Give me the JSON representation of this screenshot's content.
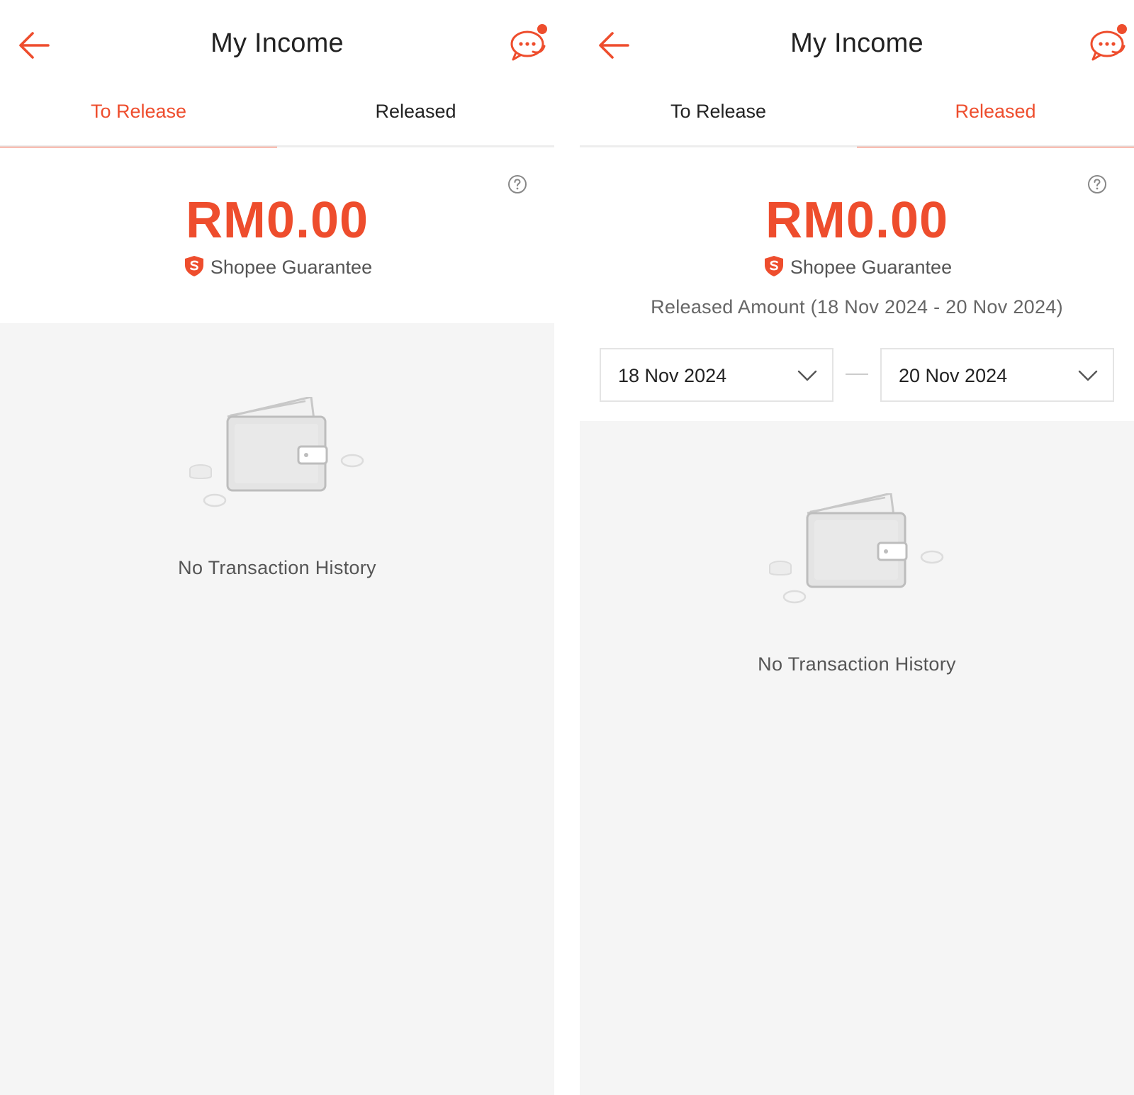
{
  "colors": {
    "accent": "#ee4d2d",
    "background": "#f5f5f5",
    "text": "#222222"
  },
  "screens": [
    {
      "title": "My Income",
      "tabs": [
        "To Release",
        "Released"
      ],
      "active_tab": "To Release",
      "amount": "RM0.00",
      "guarantee": "Shopee Guarantee",
      "empty_text": "No Transaction History",
      "icons": [
        "back-arrow-icon",
        "chat-icon",
        "help-icon",
        "shield-icon",
        "wallet-illustration-icon"
      ]
    },
    {
      "title": "My Income",
      "tabs": [
        "To Release",
        "Released"
      ],
      "active_tab": "Released",
      "amount": "RM0.00",
      "guarantee": "Shopee Guarantee",
      "range_note": "Released Amount (18 Nov 2024 - 20 Nov 2024)",
      "start_date": "18 Nov 2024",
      "end_date": "20 Nov 2024",
      "empty_text": "No Transaction History",
      "icons": [
        "back-arrow-icon",
        "chat-icon",
        "help-icon",
        "shield-icon",
        "chevron-down-icon",
        "wallet-illustration-icon"
      ]
    }
  ]
}
